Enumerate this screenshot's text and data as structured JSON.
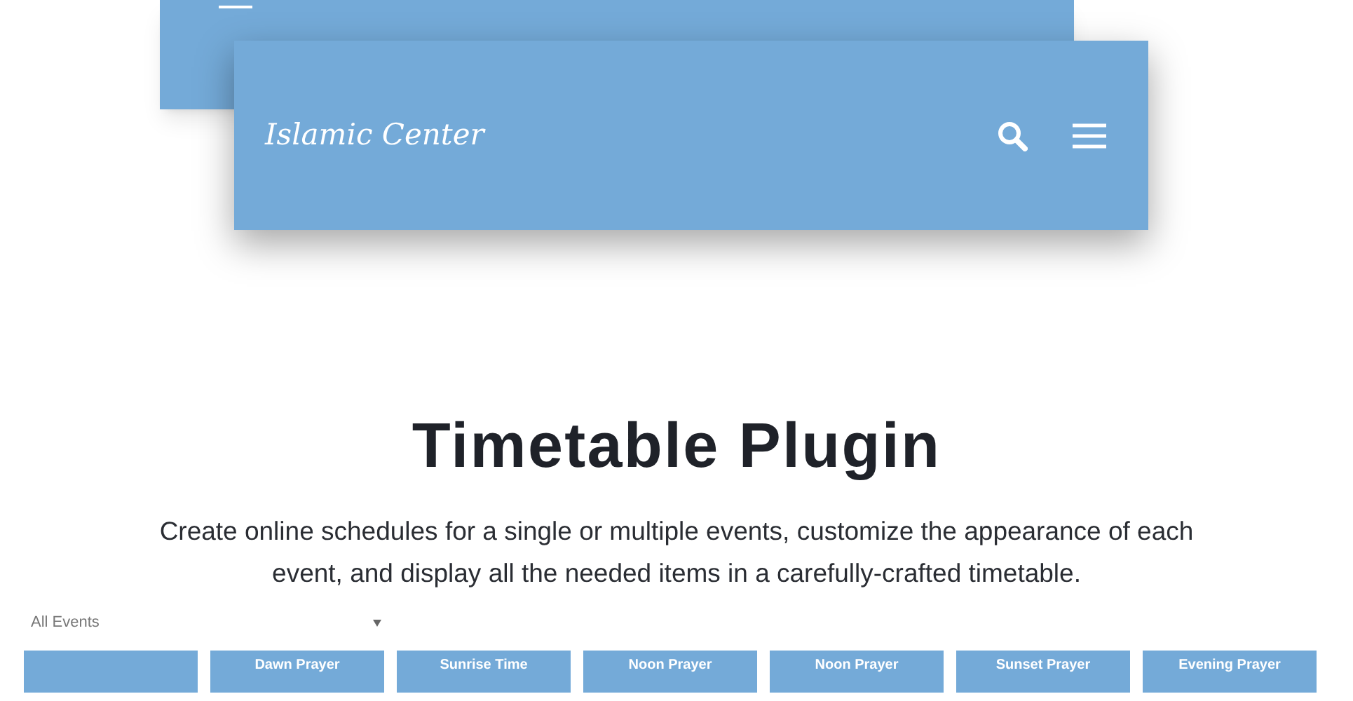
{
  "header_preview": {
    "title": "Islamic Center"
  },
  "section": {
    "title": "Timetable Plugin",
    "description": "Create online schedules for a single or multiple events, customize the appearance of each event, and display all the needed items in a carefully-crafted timetable."
  },
  "filter": {
    "value": "All Events"
  },
  "timetable": {
    "columns": [
      "Dawn Prayer",
      "Sunrise Time",
      "Noon Prayer",
      "Noon Prayer",
      "Sunset Prayer",
      "Evening Prayer"
    ]
  }
}
